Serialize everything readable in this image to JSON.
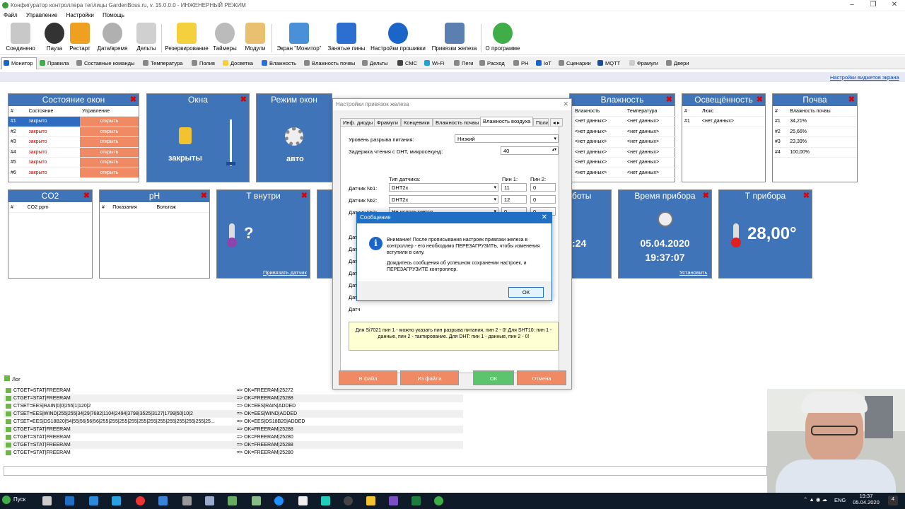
{
  "window": {
    "title": "Конфигуратор контроллера теплицы GardenBoss.ru, v. 15.0.0.0 - ИНЖЕНЕРНЫЙ РЕЖИМ"
  },
  "menu": [
    "Файл",
    "Управление",
    "Настройки",
    "Помощь"
  ],
  "toolbar": [
    {
      "label": "Соединено",
      "icon": "plug-icon",
      "color": "#c8c8c8"
    },
    {
      "label": "Пауза",
      "icon": "pause-icon",
      "color": "#333333"
    },
    {
      "label": "Рестарт",
      "icon": "restart-icon",
      "color": "#f0a020"
    },
    {
      "label": "Дата/время",
      "icon": "alarm-clock-icon",
      "color": "#b0b0b0"
    },
    {
      "label": "Дельты",
      "icon": "notepad-icon",
      "color": "#d0d0d0"
    },
    {
      "label": "Резервирование",
      "icon": "shirt-icon",
      "color": "#f4d03f"
    },
    {
      "label": "Таймеры",
      "icon": "stopwatch-icon",
      "color": "#bbbbbb"
    },
    {
      "label": "Модули",
      "icon": "tools-icon",
      "color": "#e8c070"
    },
    {
      "label": "Экран \"Монитор\"",
      "icon": "monitor-icon",
      "color": "#4a90d9"
    },
    {
      "label": "Занятые пины",
      "icon": "pin-icon",
      "color": "#2c6fd1"
    },
    {
      "label": "Настройки прошивки",
      "icon": "info-icon",
      "color": "#1b64c8"
    },
    {
      "label": "Привязки железа",
      "icon": "hardware-icon",
      "color": "#5a7fb0"
    },
    {
      "label": "О программе",
      "icon": "check-icon",
      "color": "#3fae49"
    }
  ],
  "tabs": [
    "Монитор",
    "Правила",
    "Составные команды",
    "Температура",
    "Полив",
    "Досветка",
    "Влажность",
    "Влажность почвы",
    "Дельты",
    "СМС",
    "Wi-Fi",
    "Пеги",
    "Расход",
    "PH",
    "IoT",
    "Сценарии",
    "MQTT",
    "Фрамуги",
    "Двери"
  ],
  "widget_link": "Настройки виджетов экрана",
  "windows_state": {
    "title": "Состояние окон",
    "columns": [
      "#",
      "Состояние",
      "Управление"
    ],
    "rows": [
      {
        "n": "#1",
        "state": "закрыто",
        "action": "открыть"
      },
      {
        "n": "#2",
        "state": "закрыто",
        "action": "открыть"
      },
      {
        "n": "#3",
        "state": "закрыто",
        "action": "открыть"
      },
      {
        "n": "#4",
        "state": "закрыто",
        "action": "открыть"
      },
      {
        "n": "#5",
        "state": "закрыто",
        "action": "открыть"
      },
      {
        "n": "#6",
        "state": "закрыто",
        "action": "открыть"
      }
    ]
  },
  "windows_panel": {
    "title": "Окна",
    "state": "закрыты"
  },
  "window_mode": {
    "title": "Режим окон",
    "state": "авто"
  },
  "humidity": {
    "title": "Влажность",
    "columns": [
      "Влажность",
      "Температура"
    ],
    "rows": [
      "<нет данных>",
      "<нет данных>",
      "<нет данных>",
      "<нет данных>",
      "<нет данных>",
      "<нет данных>"
    ]
  },
  "light": {
    "title": "Освещённость",
    "columns": [
      "#",
      "Люкс"
    ],
    "row": {
      "n": "#1",
      "v": "<нет данных>"
    }
  },
  "soil": {
    "title": "Почва",
    "columns": [
      "#",
      "Влажность почвы"
    ],
    "rows": [
      {
        "n": "#1",
        "v": "34,21%"
      },
      {
        "n": "#2",
        "v": "25,66%"
      },
      {
        "n": "#3",
        "v": "23,39%"
      },
      {
        "n": "#4",
        "v": "100,00%"
      }
    ]
  },
  "co2": {
    "title": "CO2",
    "columns": [
      "#",
      "CO2 ppm"
    ]
  },
  "ph": {
    "title": "pH",
    "columns": [
      "#",
      "Показания",
      "Вольтаж"
    ]
  },
  "t_inside": {
    "title": "Т внутри",
    "value": "?",
    "link": "Привязать датчик"
  },
  "work_partial": {
    "title": "боты",
    "value": ":24"
  },
  "device_time": {
    "title": "Время прибора",
    "date": "05.04.2020",
    "time": "19:37:07",
    "link": "Установить"
  },
  "device_temp": {
    "title": "Т прибора",
    "value": "28,00°"
  },
  "dialog": {
    "title": "Настройки привязок железа",
    "tabs": [
      "Инф. диоды",
      "Фрамуги",
      "Концевики",
      "Влажность почвы",
      "Влажность воздуха",
      "Полив"
    ],
    "power_level_label": "Уровень разрыва питания:",
    "power_level_value": "Низкий",
    "dht_delay_label": "Задержка чтения с DHT, микросекунд:",
    "dht_delay_value": "40",
    "col_type": "Тип датчика:",
    "col_pin1": "Пин 1:",
    "col_pin2": "Пин 2:",
    "sensors": [
      {
        "label": "Датчик №1:",
        "type": "DHT2x",
        "pin1": "11",
        "pin2": "0"
      },
      {
        "label": "Датчик №2:",
        "type": "DHT2x",
        "pin1": "12",
        "pin2": "0"
      },
      {
        "label": "Датчик №3:",
        "type": "Не используется",
        "pin1": "0",
        "pin2": "0"
      }
    ],
    "hidden_rows": [
      "Датч",
      "Датч",
      "Датч",
      "Датч",
      "Датч",
      "Датч",
      "Датч"
    ],
    "note": "Для Si7021 пин 1 - можно указать пин разрыва питания, пин 2 - 0! Для SHT10: пин 1 - данные, пин 2 - тактирование. Для DHT: пин 1 - данные, пин 2 - 0!",
    "btn_to_file": "В файл",
    "btn_from_file": "Из файла",
    "btn_ok": "ОК",
    "btn_cancel": "Отмена"
  },
  "message": {
    "title": "Сообщение",
    "text1": "Внимание! После прописывания настроек привязки железа в контроллер - его необходимо ПЕРЕЗАГРУЗИТЬ, чтобы изменения вступили в силу.",
    "text2": "Дождитесь сообщения об успешном сохранении настроек, и ПЕРЕЗАГРУЗИТЕ контроллер.",
    "ok": "ОК"
  },
  "log": {
    "tab": "Лог",
    "rows": [
      {
        "cmd": "CTGET=STAT|FREERAM",
        "resp": "=> OK=FREERAM|25272"
      },
      {
        "cmd": "CTGET=STAT|FREERAM",
        "resp": "=> OK=FREERAM|25288"
      },
      {
        "cmd": "CTSET=EES|RAIN|0|0|255|1|120|2",
        "resp": "=> OK=EES|RAIN|ADDED"
      },
      {
        "cmd": "CTSET=EES|WIND|255|255|34|29|7682|1104|2494|3798|3525|3127|1799|50|10|2",
        "resp": "=> OK=EES|WIND|ADDED"
      },
      {
        "cmd": "CTSET=EES|DS18B20|54|55|56|56|56|255|255|255|255|255|255|255|255|255|255|255|25...",
        "resp": "=> OK=EES|DS18B20|ADDED"
      },
      {
        "cmd": "CTGET=STAT|FREERAM",
        "resp": "=> OK=FREERAM|25288"
      },
      {
        "cmd": "CTGET=STAT|FREERAM",
        "resp": "=> OK=FREERAM|25280"
      },
      {
        "cmd": "CTGET=STAT|FREERAM",
        "resp": "=> OK=FREERAM|25288"
      },
      {
        "cmd": "CTGET=STAT|FREERAM",
        "resp": "=> OK=FREERAM|25280"
      }
    ]
  },
  "taskbar": {
    "start": "Пуск",
    "lang": "ENG",
    "time": "19:37",
    "date": "05.04.2020",
    "notify": "4"
  },
  "colors": {
    "panel_header": "#3f74b8",
    "action_button": "#f08a64",
    "ok_green": "#5cc46c",
    "cancel_red": "#f08a64",
    "selected_row": "#2d6cc0"
  }
}
